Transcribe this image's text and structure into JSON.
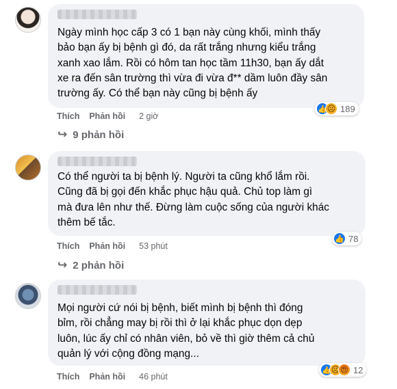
{
  "comments": [
    {
      "text": "Ngày mình học cấp 3 có 1 bạn này cùng khối, mình thấy\nbảo bạn ấy bị bệnh gì đó, da rất trắng nhưng kiểu trắng\nxanh xao lắm. Rồi có hôm tan học tầm 11h30, bạn ấy dắt\nxe ra đến sân trường thì vừa đi vừa đ** dầm luôn đầy sân\ntrường ấy. Có thể bạn này cũng bị bệnh ấy",
      "reaction_count": "189",
      "reactions": [
        "like-icon",
        "sad-icon"
      ],
      "like_label": "Thích",
      "reply_label": "Phản hồi",
      "time": "2 giờ",
      "replies": "9 phản hồi"
    },
    {
      "text": "Có thể người ta bị bệnh lý. Người ta cũng khổ lắm rồi.\nCũng đã bị gọi đến khắc phục hậu quả. Chủ top làm gì\nmà đưa lên như thế. Đừng làm cuộc sống của người khác\nthêm bế tắc.",
      "reaction_count": "78",
      "reactions": [
        "like-icon"
      ],
      "like_label": "Thích",
      "reply_label": "Phản hồi",
      "time": "53 phút",
      "replies": "2 phản hồi"
    },
    {
      "text": "Mọi người cứ nói bị bệnh, biết mình bị bệnh thì đóng\nbỉm, rồi chẳng may bị rồi thì ở lại khắc phục dọn dẹp\nluôn, lúc ấy chỉ có nhân viên, bỏ về thì giờ thêm cả chủ\nquản lý với cộng đồng mạng...",
      "reaction_count": "12",
      "reactions": [
        "like-icon",
        "sad-icon",
        "angry-icon"
      ],
      "like_label": "Thích",
      "reply_label": "Phản hồi",
      "time": "46 phút"
    }
  ],
  "colors": {
    "bubble": "#f0f2f5",
    "meta": "#65676b",
    "like": "#1877f2"
  }
}
